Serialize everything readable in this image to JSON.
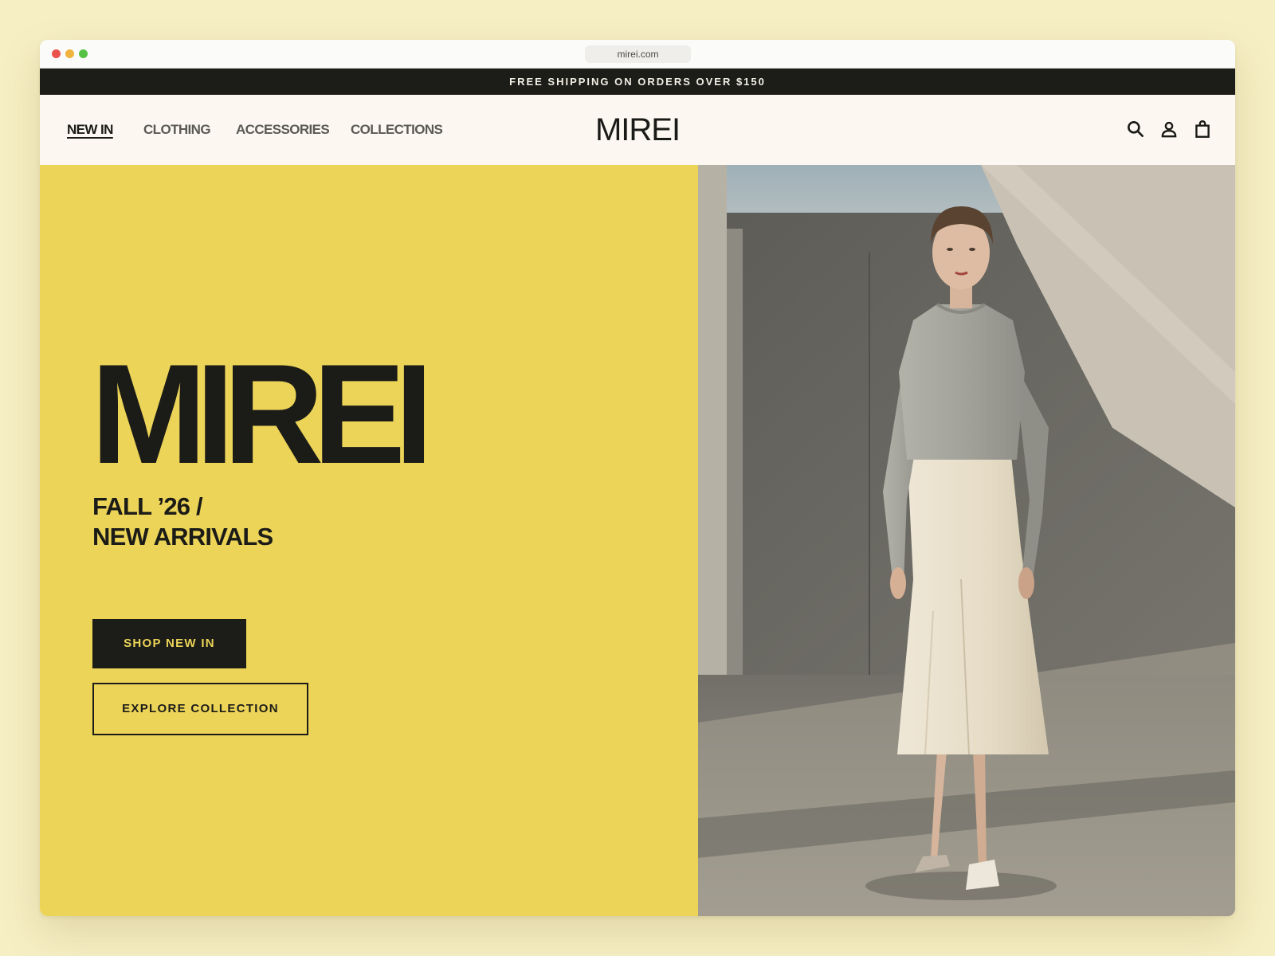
{
  "browser": {
    "url": "mirei.com",
    "traffic_lights": [
      "#e9534c",
      "#efb43c",
      "#56c144"
    ]
  },
  "announcement": {
    "text": "FREE SHIPPING ON ORDERS OVER $150"
  },
  "header": {
    "nav": [
      {
        "label": "NEW IN",
        "active": true
      },
      {
        "label": "CLOTHING",
        "active": false
      },
      {
        "label": "ACCESSORIES",
        "active": false
      },
      {
        "label": "COLLECTIONS",
        "active": false
      }
    ],
    "logo": "MIREI",
    "icons": [
      "search-icon",
      "account-icon",
      "shopping-bag-icon"
    ]
  },
  "hero": {
    "title": "MIREI",
    "subtitle_line1": "FALL ’26 /",
    "subtitle_line2": "NEW ARRIVALS",
    "primary_cta": "SHOP NEW IN",
    "secondary_cta": "EXPLORE COLLECTION",
    "image": "model-photo"
  },
  "colors": {
    "page_bg": "#f6efc4",
    "accent_yellow": "#ecd458",
    "ink": "#1c1c18",
    "header_bg": "#fcf8f1"
  }
}
